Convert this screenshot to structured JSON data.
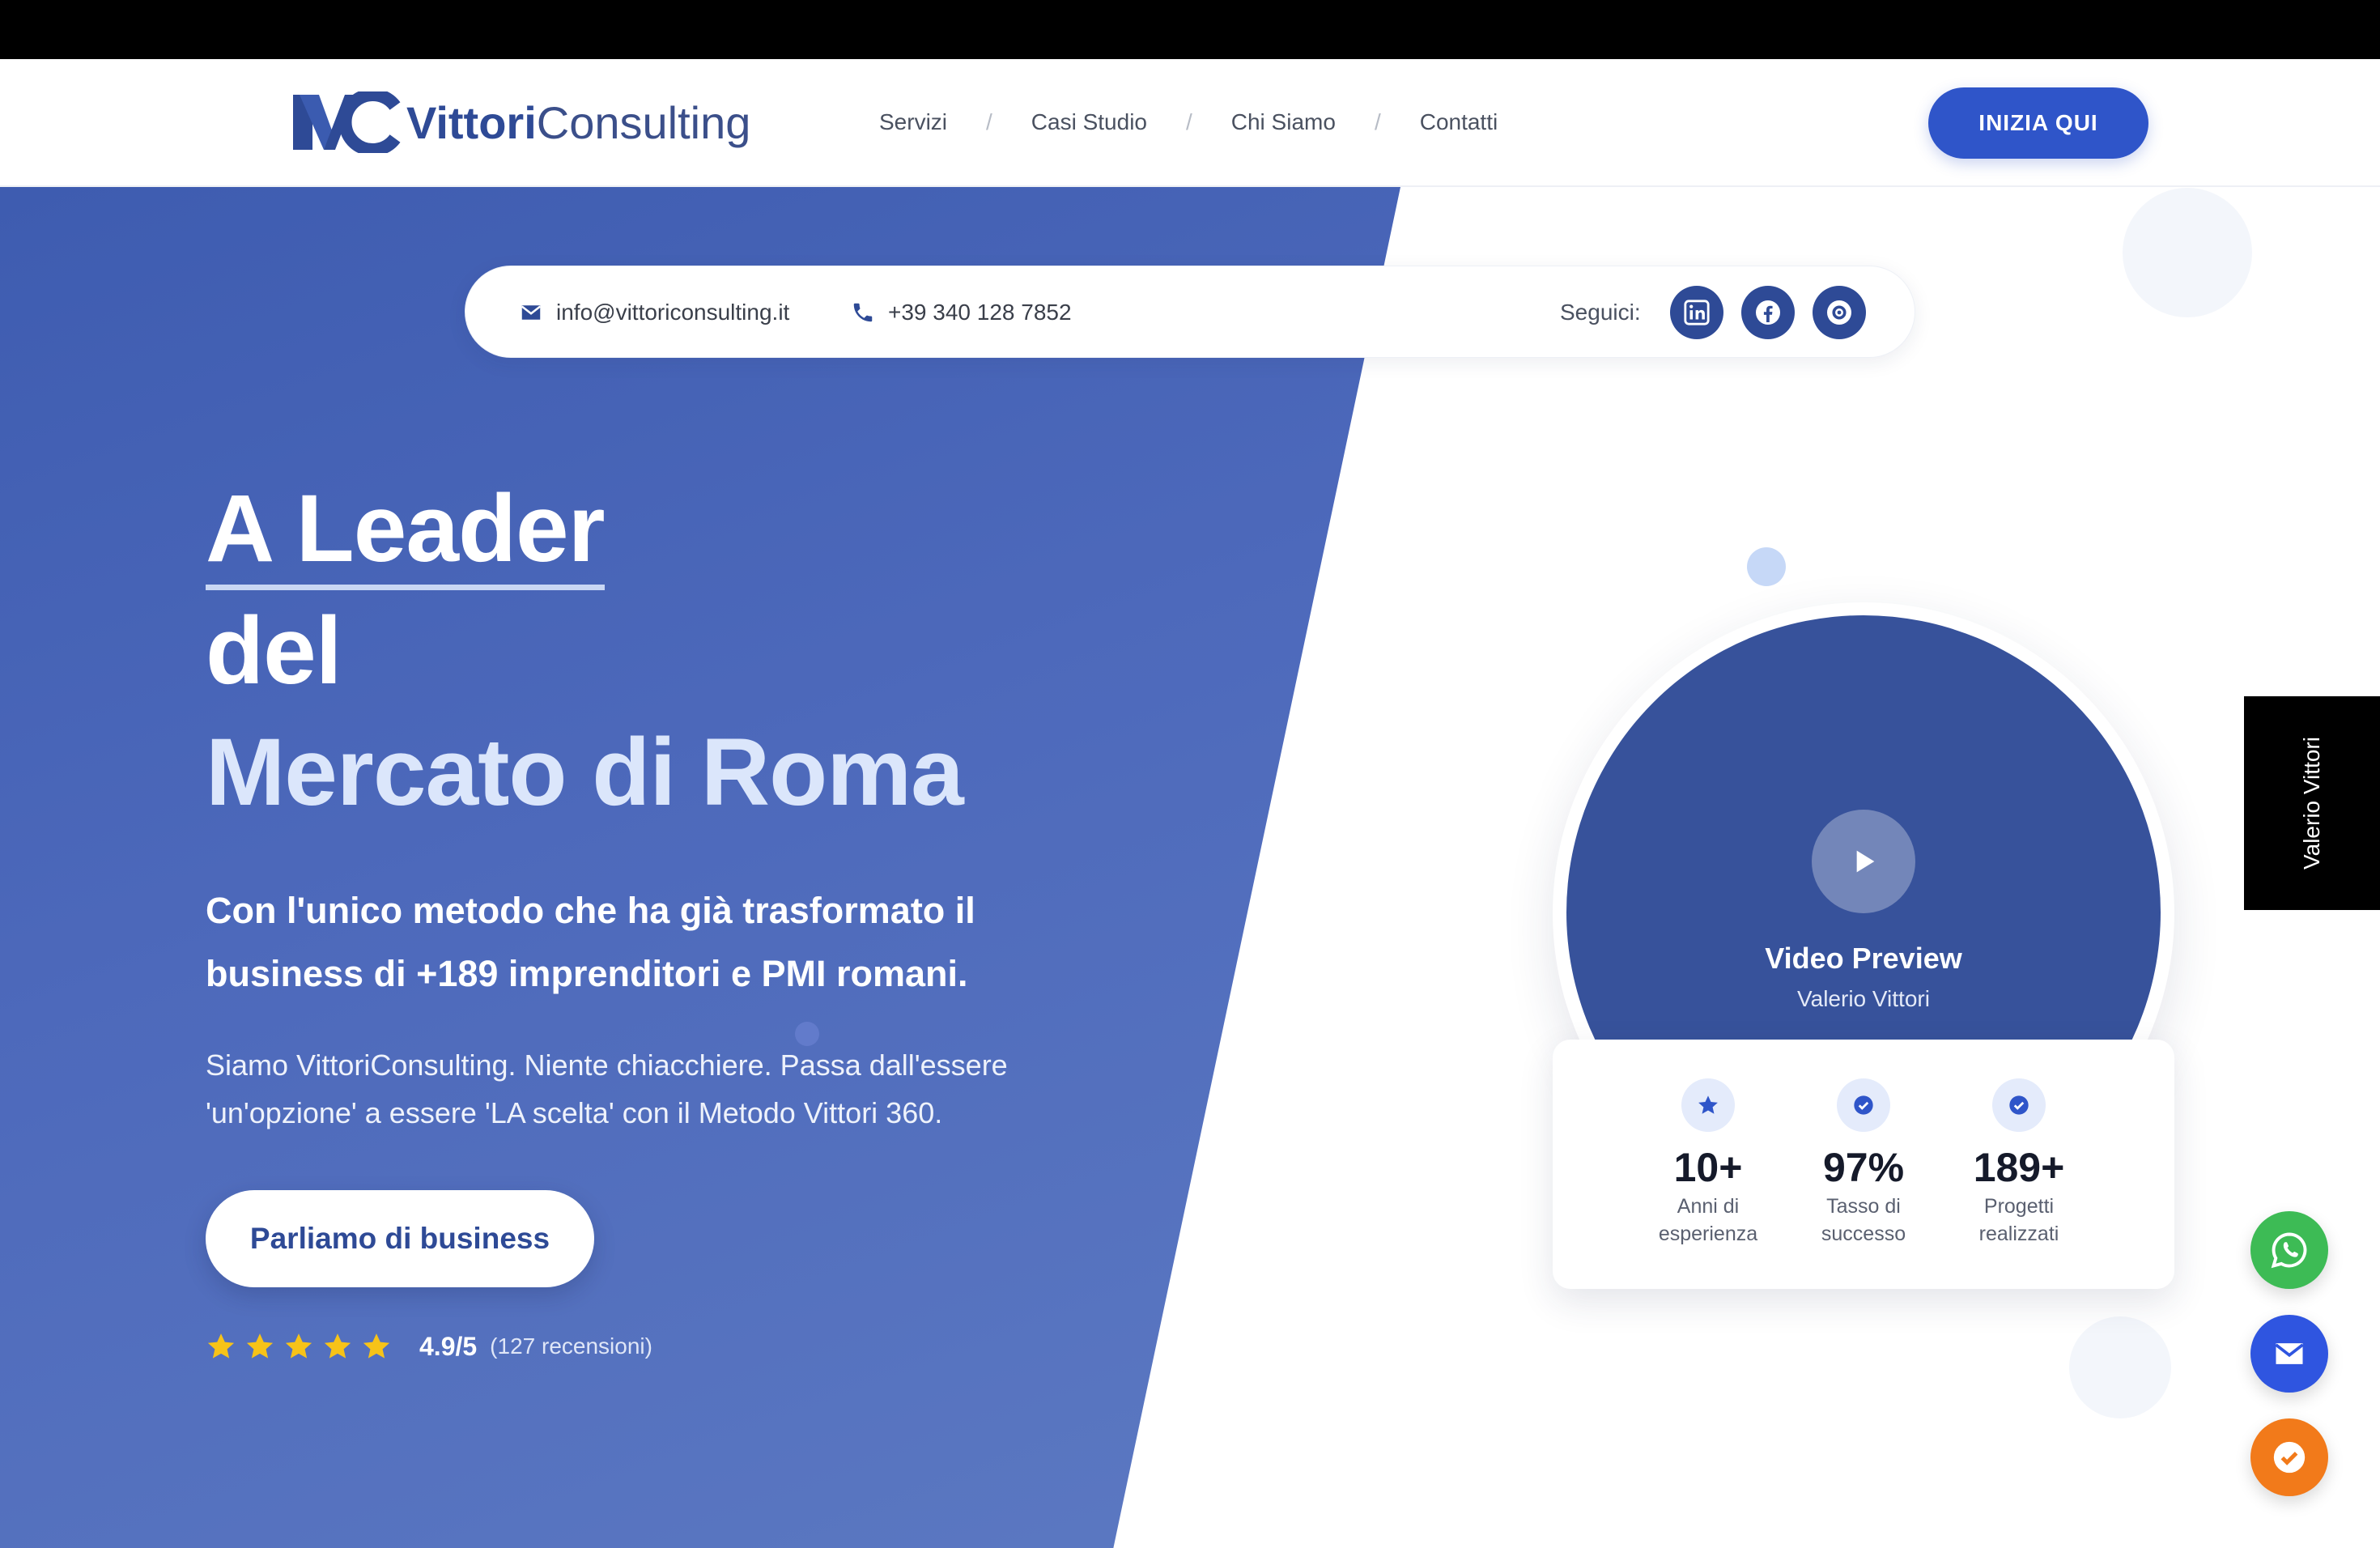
{
  "brand": {
    "name_bold": "Vittori",
    "name_light": "Consulting"
  },
  "nav": {
    "items": [
      "Servizi",
      "Casi Studio",
      "Chi Siamo",
      "Contatti"
    ],
    "separator": "/",
    "cta": "INIZIA QUI"
  },
  "contact": {
    "email": "info@vittoriconsulting.it",
    "phone": "+39 340 128 7852",
    "follow_label": "Seguici:",
    "socials": [
      "linkedin-icon",
      "facebook-icon",
      "other-social-icon"
    ]
  },
  "hero": {
    "title_line1": "A Leader",
    "title_line2": "del",
    "title_line3": "Mercato di Roma",
    "subtitle": "Con l'unico metodo che ha già trasformato il business di +189 imprenditori e PMI romani.",
    "description": "Siamo VittoriConsulting. Niente chiacchiere. Passa dall'essere 'un'opzione' a essere 'LA scelta' con il Metodo Vittori 360.",
    "cta": "Parliamo di business",
    "rating_value": "4.9/5",
    "rating_count": "(127 recensioni)",
    "stars": 5
  },
  "video": {
    "title": "Video Preview",
    "subtitle": "Valerio Vittori"
  },
  "stats": [
    {
      "value": "10+",
      "label_line1": "Anni di",
      "label_line2": "esperienza",
      "icon": "star-icon"
    },
    {
      "value": "97%",
      "label_line1": "Tasso di",
      "label_line2": "successo",
      "icon": "check-circle-icon"
    },
    {
      "value": "189+",
      "label_line1": "Progetti",
      "label_line2": "realizzati",
      "icon": "check-circle-icon"
    }
  ],
  "side_tab": "Valerio Vittori",
  "colors": {
    "primary": "#2f55c9",
    "brand_dark": "#2e4a96",
    "whatsapp": "#3dbb55",
    "mail": "#2f55e0",
    "orange": "#f27a1a",
    "star": "#f7c318"
  }
}
